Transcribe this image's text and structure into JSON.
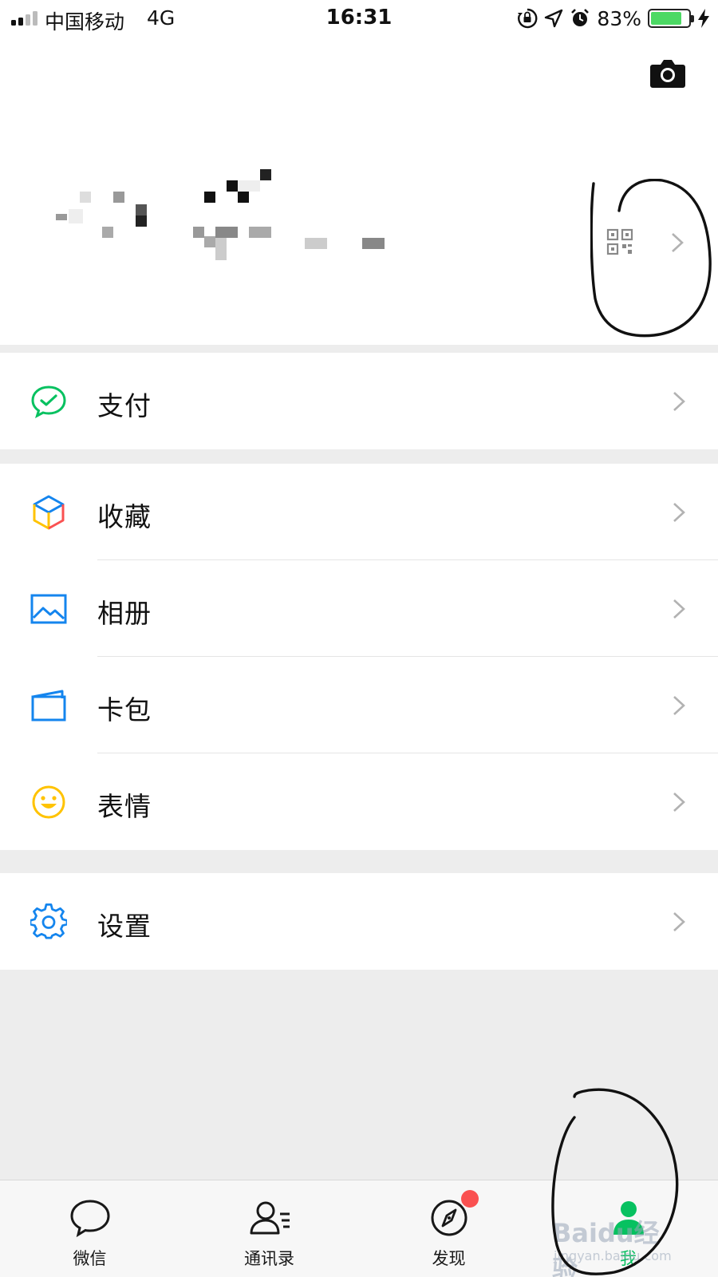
{
  "status_bar": {
    "carrier": "中国移动",
    "network": "4G",
    "time": "16:31",
    "battery_percent": "83%",
    "battery_level": 0.83,
    "battery_color": "#4cd964",
    "icons": [
      "signal-icon",
      "orientation-lock-icon",
      "location-icon",
      "alarm-icon",
      "battery-icon",
      "charging-icon"
    ]
  },
  "profile": {
    "camera_icon": "camera-icon",
    "qr_icon": "qr-code-icon",
    "arrow_icon": "chevron-right-icon"
  },
  "menu": {
    "pay": {
      "label": "支付",
      "icon": "wechat-pay-icon",
      "color": "#07c160"
    },
    "favorites": {
      "label": "收藏",
      "icon": "cube-icon"
    },
    "album": {
      "label": "相册",
      "icon": "picture-icon",
      "color": "#1485ee"
    },
    "cards": {
      "label": "卡包",
      "icon": "wallet-icon",
      "color": "#1485ee"
    },
    "stickers": {
      "label": "表情",
      "icon": "smiley-icon",
      "color": "#ffc300"
    },
    "settings": {
      "label": "设置",
      "icon": "gear-icon",
      "color": "#1485ee"
    }
  },
  "tabbar": {
    "active_color": "#07c160",
    "tabs": [
      {
        "label": "微信",
        "icon": "chat-bubble-icon"
      },
      {
        "label": "通讯录",
        "icon": "contacts-icon"
      },
      {
        "label": "发现",
        "icon": "compass-icon",
        "badge_color": "#fa5151"
      },
      {
        "label": "我",
        "icon": "me-icon",
        "active": true
      }
    ]
  },
  "watermark": {
    "text": "Baidu经验",
    "sub": "jingyan.baidu.com"
  }
}
